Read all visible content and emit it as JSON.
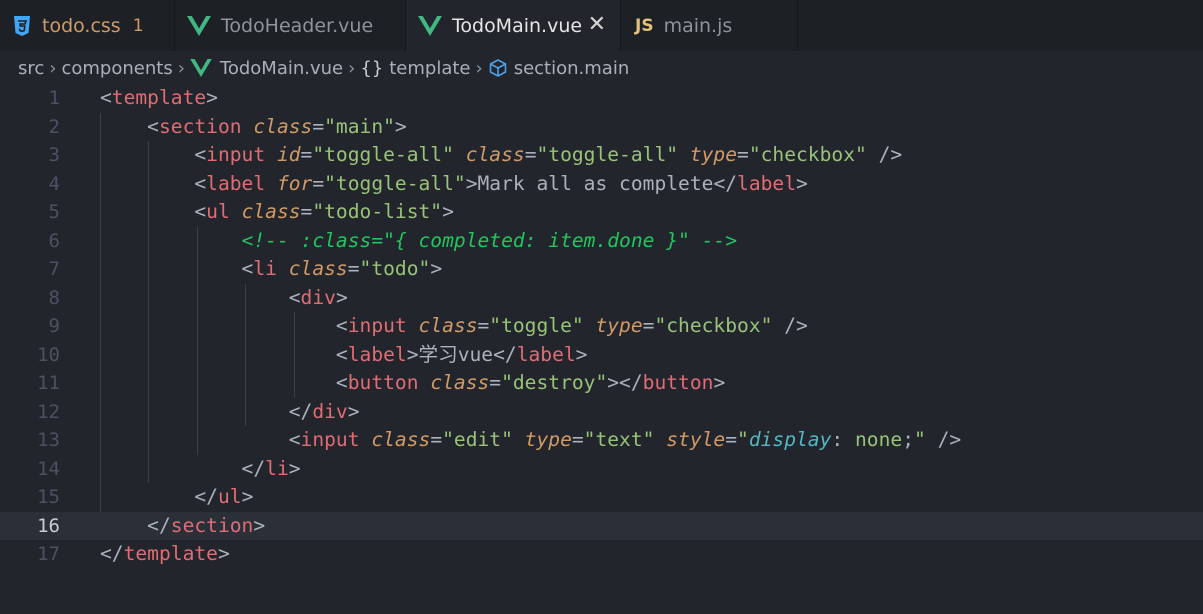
{
  "tabs": [
    {
      "label": "todo.css",
      "icon": "css-file-icon",
      "badge": "1",
      "active": false
    },
    {
      "label": "TodoHeader.vue",
      "icon": "vue-file-icon",
      "active": false
    },
    {
      "label": "TodoMain.vue",
      "icon": "vue-file-icon",
      "active": true
    },
    {
      "label": "main.js",
      "icon": "js-file-icon",
      "icon_text": "JS",
      "active": false
    }
  ],
  "breadcrumb": {
    "items": [
      "src",
      "components",
      "TodoMain.vue",
      "template",
      "section.main"
    ],
    "braces": "{}"
  },
  "editor": {
    "current_line": 16,
    "line_numbers": [
      "1",
      "2",
      "3",
      "4",
      "5",
      "6",
      "7",
      "8",
      "9",
      "10",
      "11",
      "12",
      "13",
      "14",
      "15",
      "16",
      "17"
    ],
    "lines": [
      [
        [
          "p",
          "<"
        ],
        [
          "t",
          "template"
        ],
        [
          "p",
          ">"
        ]
      ],
      [
        [
          "p",
          "    <"
        ],
        [
          "t",
          "section"
        ],
        [
          "p",
          " "
        ],
        [
          "a",
          "class"
        ],
        [
          "p",
          "="
        ],
        [
          "s",
          "\"main\""
        ],
        [
          "p",
          ">"
        ]
      ],
      [
        [
          "p",
          "        <"
        ],
        [
          "t",
          "input"
        ],
        [
          "p",
          " "
        ],
        [
          "a",
          "id"
        ],
        [
          "p",
          "="
        ],
        [
          "s",
          "\"toggle-all\""
        ],
        [
          "p",
          " "
        ],
        [
          "a",
          "class"
        ],
        [
          "p",
          "="
        ],
        [
          "s",
          "\"toggle-all\""
        ],
        [
          "p",
          " "
        ],
        [
          "a",
          "type"
        ],
        [
          "p",
          "="
        ],
        [
          "s",
          "\"checkbox\""
        ],
        [
          "p",
          " />"
        ]
      ],
      [
        [
          "p",
          "        <"
        ],
        [
          "t",
          "label"
        ],
        [
          "p",
          " "
        ],
        [
          "a",
          "for"
        ],
        [
          "p",
          "="
        ],
        [
          "s",
          "\"toggle-all\""
        ],
        [
          "p",
          ">"
        ],
        [
          "x",
          "Mark all as complete"
        ],
        [
          "p",
          "</"
        ],
        [
          "t",
          "label"
        ],
        [
          "p",
          ">"
        ]
      ],
      [
        [
          "p",
          "        <"
        ],
        [
          "t",
          "ul"
        ],
        [
          "p",
          " "
        ],
        [
          "a",
          "class"
        ],
        [
          "p",
          "="
        ],
        [
          "s",
          "\"todo-list\""
        ],
        [
          "p",
          ">"
        ]
      ],
      [
        [
          "p",
          "            "
        ],
        [
          "c",
          "<!-- :class=\"{ completed: item.done }\" -->"
        ]
      ],
      [
        [
          "p",
          "            <"
        ],
        [
          "t",
          "li"
        ],
        [
          "p",
          " "
        ],
        [
          "a",
          "class"
        ],
        [
          "p",
          "="
        ],
        [
          "s",
          "\"todo\""
        ],
        [
          "p",
          ">"
        ]
      ],
      [
        [
          "p",
          "                <"
        ],
        [
          "t",
          "div"
        ],
        [
          "p",
          ">"
        ]
      ],
      [
        [
          "p",
          "                    <"
        ],
        [
          "t",
          "input"
        ],
        [
          "p",
          " "
        ],
        [
          "a",
          "class"
        ],
        [
          "p",
          "="
        ],
        [
          "s",
          "\"toggle\""
        ],
        [
          "p",
          " "
        ],
        [
          "a",
          "type"
        ],
        [
          "p",
          "="
        ],
        [
          "s",
          "\"checkbox\""
        ],
        [
          "p",
          " />"
        ]
      ],
      [
        [
          "p",
          "                    <"
        ],
        [
          "t",
          "label"
        ],
        [
          "p",
          ">"
        ],
        [
          "x",
          "学习vue"
        ],
        [
          "p",
          "</"
        ],
        [
          "t",
          "label"
        ],
        [
          "p",
          ">"
        ]
      ],
      [
        [
          "p",
          "                    <"
        ],
        [
          "t",
          "button"
        ],
        [
          "p",
          " "
        ],
        [
          "a",
          "class"
        ],
        [
          "p",
          "="
        ],
        [
          "s",
          "\"destroy\""
        ],
        [
          "p",
          "></"
        ],
        [
          "t",
          "button"
        ],
        [
          "p",
          ">"
        ]
      ],
      [
        [
          "p",
          "                </"
        ],
        [
          "t",
          "div"
        ],
        [
          "p",
          ">"
        ]
      ],
      [
        [
          "p",
          "                <"
        ],
        [
          "t",
          "input"
        ],
        [
          "p",
          " "
        ],
        [
          "a",
          "class"
        ],
        [
          "p",
          "="
        ],
        [
          "s",
          "\"edit\""
        ],
        [
          "p",
          " "
        ],
        [
          "a",
          "type"
        ],
        [
          "p",
          "="
        ],
        [
          "s",
          "\"text\""
        ],
        [
          "p",
          " "
        ],
        [
          "a",
          "style"
        ],
        [
          "p",
          "="
        ],
        [
          "s",
          "\""
        ],
        [
          "k",
          "display"
        ],
        [
          "p",
          ": "
        ],
        [
          "s",
          "none"
        ],
        [
          "p",
          ";"
        ],
        [
          "s",
          "\""
        ],
        [
          "p",
          " />"
        ]
      ],
      [
        [
          "p",
          "            </"
        ],
        [
          "t",
          "li"
        ],
        [
          "p",
          ">"
        ]
      ],
      [
        [
          "p",
          "        </"
        ],
        [
          "t",
          "ul"
        ],
        [
          "p",
          ">"
        ]
      ],
      [
        [
          "p",
          "    </"
        ],
        [
          "t",
          "section"
        ],
        [
          "p",
          ">"
        ]
      ],
      [
        [
          "p",
          "</"
        ],
        [
          "t",
          "template"
        ],
        [
          "p",
          ">"
        ]
      ]
    ]
  },
  "colors": {
    "tag": "#e06c75",
    "attribute": "#d19a66",
    "string": "#98c379",
    "comment": "#22c55e",
    "css_property": "#56b6c2",
    "vue_icon": "#41b883",
    "css_icon": "#42a5f5",
    "js_icon": "#e5c07b"
  }
}
